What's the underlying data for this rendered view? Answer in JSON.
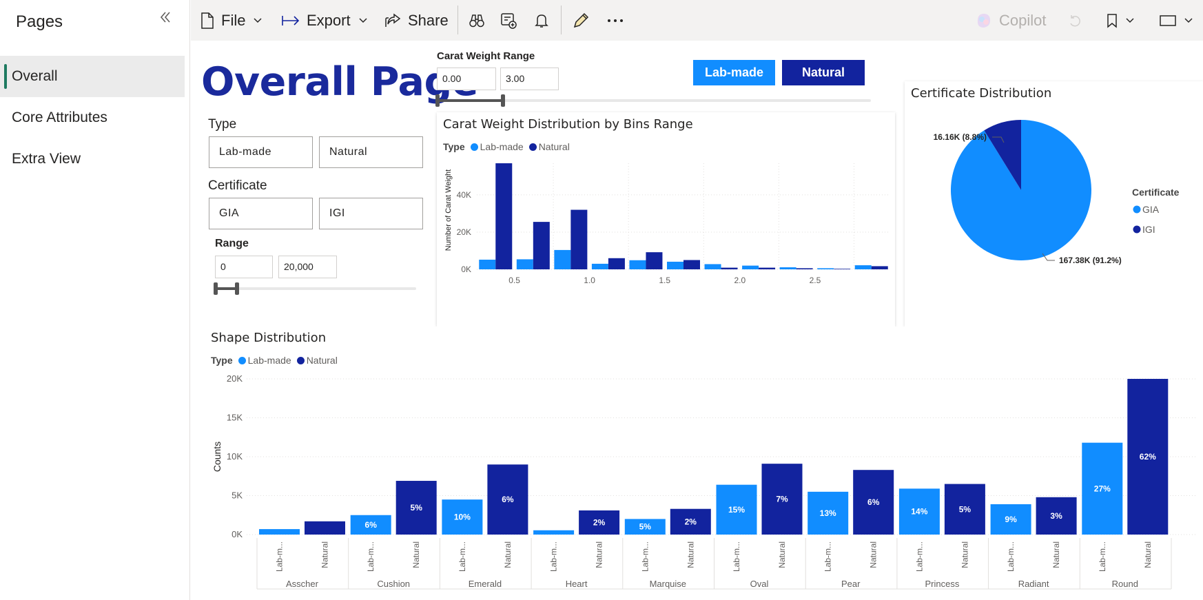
{
  "colors": {
    "lab": "#118dff",
    "natural": "#12239e",
    "title": "#1a2a9c"
  },
  "sidebar": {
    "title": "Pages",
    "collapse_icon": "chevron-double-left-icon",
    "items": [
      {
        "label": "Overall",
        "active": true
      },
      {
        "label": "Core Attributes",
        "active": false
      },
      {
        "label": "Extra View",
        "active": false
      }
    ]
  },
  "toolbar": {
    "file": "File",
    "export": "Export",
    "share": "Share",
    "copilot": "Copilot"
  },
  "page": {
    "title": "Overall Page",
    "type_label": "Type",
    "type_options": [
      "Lab-made",
      "Natural"
    ],
    "certificate_label": "Certificate",
    "certificate_options": [
      "GIA",
      "IGI"
    ],
    "range_label": "Range",
    "range_min": "0",
    "range_max": "20,000",
    "carat_label": "Carat Weight Range",
    "carat_min": "0.00",
    "carat_max": "3.00",
    "buttons": {
      "lab": "Lab-made",
      "natural": "Natural"
    }
  },
  "chart_data": [
    {
      "type": "bar",
      "title": "Carat Weight Distribution by Bins Range",
      "legend_title": "Type",
      "ylabel": "Number of Carat Weight",
      "xlabel": "",
      "x_ticks": [
        "0.5",
        "1.0",
        "1.5",
        "2.0",
        "2.5"
      ],
      "y_ticks": [
        "0K",
        "20K",
        "40K"
      ],
      "ylim": [
        0,
        57000
      ],
      "categories": [
        "0.25",
        "0.5",
        "0.75",
        "1.0",
        "1.25",
        "1.5",
        "1.75",
        "2.0",
        "2.25",
        "2.5",
        "2.75"
      ],
      "series": [
        {
          "name": "Lab-made",
          "values": [
            5200,
            5400,
            10400,
            3000,
            4900,
            4100,
            2800,
            2000,
            1100,
            600,
            2200
          ]
        },
        {
          "name": "Natural",
          "values": [
            57000,
            25500,
            32000,
            6000,
            9200,
            5000,
            900,
            900,
            600,
            300,
            1700
          ]
        }
      ]
    },
    {
      "type": "pie",
      "title": "Certificate Distribution",
      "legend_title": "Certificate",
      "slices": [
        {
          "name": "GIA",
          "value": 167380,
          "label": "167.38K (91.2%)"
        },
        {
          "name": "IGI",
          "value": 16160,
          "label": "16.16K (8.8%)"
        }
      ]
    },
    {
      "type": "bar",
      "title": "Shape Distribution",
      "legend_title": "Type",
      "ylabel": "Counts",
      "xlabel": "",
      "y_ticks": [
        "0K",
        "5K",
        "10K",
        "15K",
        "20K"
      ],
      "ylim": [
        0,
        20000
      ],
      "categories": [
        "Asscher",
        "Cushion",
        "Emerald",
        "Heart",
        "Marquise",
        "Oval",
        "Pear",
        "Princess",
        "Radiant",
        "Round"
      ],
      "sub_labels": [
        "Lab-m...",
        "Natural"
      ],
      "series": [
        {
          "name": "Lab-made",
          "values": [
            700,
            2500,
            4500,
            550,
            2000,
            6400,
            5500,
            5900,
            3900,
            11800
          ],
          "labels": [
            "",
            "6%",
            "10%",
            "",
            "5%",
            "15%",
            "13%",
            "14%",
            "9%",
            "27%"
          ]
        },
        {
          "name": "Natural",
          "values": [
            1700,
            6900,
            9000,
            3100,
            3300,
            9100,
            8300,
            6500,
            4800,
            20000
          ],
          "labels": [
            "",
            "5%",
            "6%",
            "2%",
            "2%",
            "7%",
            "6%",
            "5%",
            "3%",
            "62%"
          ]
        }
      ]
    }
  ]
}
